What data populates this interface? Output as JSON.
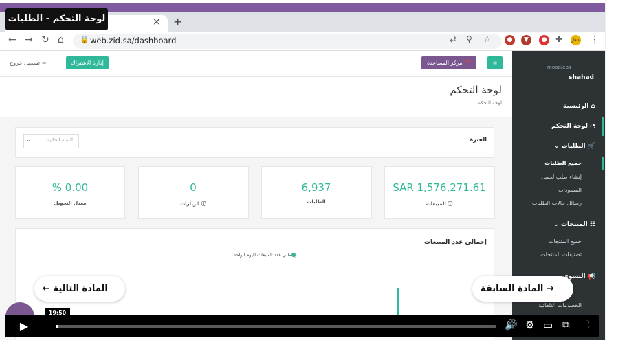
{
  "browser": {
    "tab_title": "",
    "url": "web.zid.sa/dashboard",
    "new_tab": "+",
    "close": "×",
    "avatar_text": "شعار"
  },
  "overlay": {
    "title_tag": "لوحة التحكم - الطلبات",
    "prev_label": "المادة السابقة",
    "next_label": "المادة التالية",
    "time": "19:50"
  },
  "sidebar": {
    "brand": "mood/ebs",
    "user": "shahad",
    "items": [
      {
        "label": "الرئيسية"
      },
      {
        "label": "لوحة التحكم"
      },
      {
        "label": "الطلبات"
      },
      {
        "label": "المنتجات"
      },
      {
        "label": "التسوي"
      }
    ],
    "orders_sub": [
      "جميع الطلبات",
      "إنشاء طلب لعميل",
      "المسودات",
      "رسائل حالات الطلبات"
    ],
    "products_sub": [
      "جميع المنتجات",
      "تصنيفات المنتجات"
    ],
    "marketing_sub": [
      "الخصومات التلقائية"
    ]
  },
  "header": {
    "help": "مركز المساعدة",
    "subscription": "إدارة الاشتراك",
    "logout": "تسجيل خروج"
  },
  "page": {
    "title": "لوحة التحكم",
    "breadcrumb": "لوحة التحكم"
  },
  "filter": {
    "label": "الفترة",
    "selected": "السنة الحالية"
  },
  "stats": [
    {
      "label": "المبيعات",
      "value": "SAR 1,576,271.61"
    },
    {
      "label": "الطلبات",
      "value": "6,937"
    },
    {
      "label": "الزيارات",
      "value": "0"
    },
    {
      "label": "معدل التحويل",
      "value": "% 0.00"
    }
  ],
  "chart": {
    "title": "إجمالي عدد المبيعات",
    "legend": "إجمالي عدد المبيعات لليوم الواحد",
    "color": "#2fb99a"
  },
  "colors": {
    "accent": "#2fb99a",
    "purple": "#7b5790",
    "sidebar": "#2d3235"
  }
}
